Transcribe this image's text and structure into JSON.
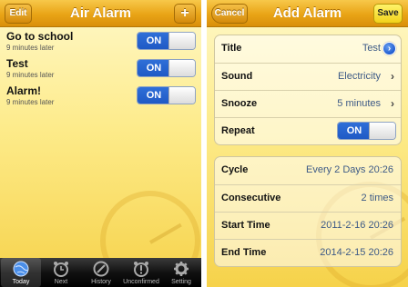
{
  "left": {
    "nav": {
      "title": "Air Alarm",
      "edit_label": "Edit",
      "add_label": "+"
    },
    "alarms": [
      {
        "name": "Go to school",
        "subtitle": "9 minutes later",
        "toggle": "ON"
      },
      {
        "name": "Test",
        "subtitle": "9 minutes later",
        "toggle": "ON"
      },
      {
        "name": "Alarm!",
        "subtitle": "9 minutes later",
        "toggle": "ON"
      }
    ],
    "tabs": [
      {
        "label": "Today",
        "icon": "globe-icon",
        "active": true
      },
      {
        "label": "Next",
        "icon": "clock-icon",
        "active": false
      },
      {
        "label": "History",
        "icon": "compass-icon",
        "active": false
      },
      {
        "label": "Unconfirmed",
        "icon": "alarm-alert-icon",
        "active": false
      },
      {
        "label": "Setting",
        "icon": "gear-icon",
        "active": false
      }
    ]
  },
  "right": {
    "nav": {
      "title": "Add Alarm",
      "cancel_label": "Cancel",
      "save_label": "Save"
    },
    "settings": {
      "title_label": "Title",
      "title_value": "Test",
      "sound_label": "Sound",
      "sound_value": "Electricity",
      "snooze_label": "Snooze",
      "snooze_value": "5 minutes",
      "repeat_label": "Repeat",
      "repeat_toggle": "ON"
    },
    "schedule": {
      "cycle_label": "Cycle",
      "cycle_value": "Every 2 Days 20:26",
      "consecutive_label": "Consecutive",
      "consecutive_value": "2 times",
      "start_label": "Start Time",
      "start_value": "2011-2-16 20:26",
      "end_label": "End Time",
      "end_value": "2014-2-15 20:26"
    }
  },
  "colors": {
    "nav_orange": "#e9a416",
    "toggle_blue": "#1f5ac5",
    "value_blue": "#3d5a86",
    "background_yellow": "#fdeb8a"
  }
}
